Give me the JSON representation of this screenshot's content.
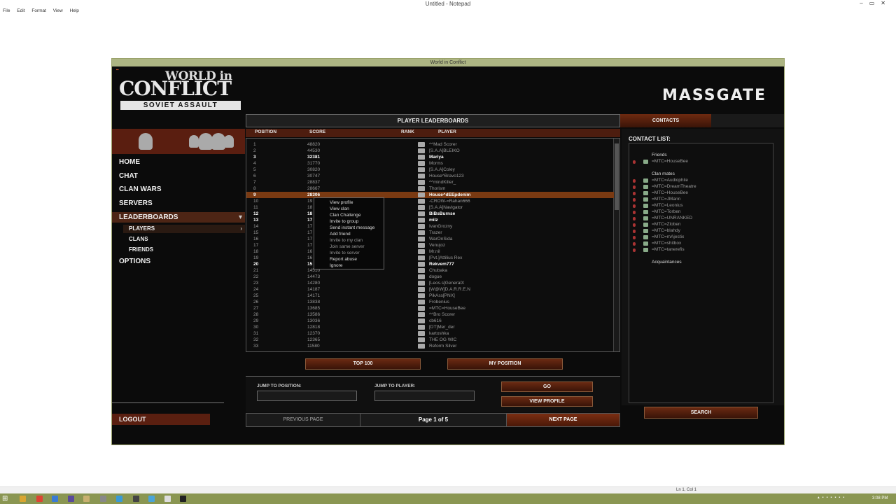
{
  "notepad": {
    "title": "Untitled - Notepad",
    "menu": [
      "File",
      "Edit",
      "Format",
      "View",
      "Help"
    ],
    "status": "Ln 1, Col 1"
  },
  "taskbar": {
    "clock": "3:08 PM"
  },
  "game": {
    "window_title": "World in Conflict",
    "logo": {
      "line1": "WORLD in",
      "line2": "CONFLICT",
      "line3": "SOVIET ASSAULT"
    },
    "massgate": "MASSGATE",
    "nav": {
      "home": "HOME",
      "chat": "CHAT",
      "clan_wars": "CLAN WARS",
      "servers": "SERVERS",
      "leaderboards": "LEADERBOARDS",
      "players": "PLAYERS",
      "clans": "CLANS",
      "friends": "FRIENDS",
      "options": "OPTIONS",
      "logout": "LOGOUT"
    },
    "leaderboard": {
      "title": "PLAYER LEADERBOARDS",
      "columns": {
        "position": "POSITION",
        "score": "SCORE",
        "rank": "RANK",
        "player": "PLAYER"
      },
      "rows": [
        {
          "pos": "1",
          "score": "48820",
          "player": "^^Mad Scorer"
        },
        {
          "pos": "2",
          "score": "44530",
          "player": "[S.A.A]BLEIKO"
        },
        {
          "pos": "3",
          "score": "32381",
          "player": "Mariya"
        },
        {
          "pos": "4",
          "score": "31770",
          "player": "Morms"
        },
        {
          "pos": "5",
          "score": "30820",
          "player": "[S.A.A]Coley"
        },
        {
          "pos": "6",
          "score": "30747",
          "player": "House^Bravo123"
        },
        {
          "pos": "7",
          "score": "28837",
          "player": "^^mindKiller_"
        },
        {
          "pos": "8",
          "score": "28667",
          "player": "Thorism"
        },
        {
          "pos": "9",
          "score": "28306",
          "player": "House^dEEpdenim"
        },
        {
          "pos": "10",
          "score": "19",
          "player": "-CROW-=Rahan666"
        },
        {
          "pos": "11",
          "score": "18",
          "player": "[S.A.A]Navigator"
        },
        {
          "pos": "12",
          "score": "18",
          "player": "BiBsBurnse"
        },
        {
          "pos": "13",
          "score": "17",
          "player": "milz"
        },
        {
          "pos": "14",
          "score": "17",
          "player": "IvanGrozny"
        },
        {
          "pos": "15",
          "score": "17",
          "player": "Trazer"
        },
        {
          "pos": "16",
          "score": "17",
          "player": "WarOnSida"
        },
        {
          "pos": "17",
          "score": "17",
          "player": "Venujoz"
        },
        {
          "pos": "18",
          "score": "16",
          "player": "Mr.nil"
        },
        {
          "pos": "19",
          "score": "16",
          "player": "[Pvt.]Attilius Rex"
        },
        {
          "pos": "20",
          "score": "15",
          "player": "Rekvem777"
        },
        {
          "pos": "21",
          "score": "14510",
          "player": "Chubaka"
        },
        {
          "pos": "22",
          "score": "14473",
          "player": "dogue"
        },
        {
          "pos": "23",
          "score": "14280",
          "player": "[Leos.s]GeneralX"
        },
        {
          "pos": "24",
          "score": "14187",
          "player": "[W@W]D.A.R.R.E.N"
        },
        {
          "pos": "25",
          "score": "14171",
          "player": "PikAss[PNX]"
        },
        {
          "pos": "26",
          "score": "13838",
          "player": "Frobenius"
        },
        {
          "pos": "27",
          "score": "13685",
          "player": "=MTC=HouseBee"
        },
        {
          "pos": "28",
          "score": "13586",
          "player": "^^Bro Scorer"
        },
        {
          "pos": "29",
          "score": "13036",
          "player": "cb616"
        },
        {
          "pos": "30",
          "score": "12818",
          "player": "[DT]Mer_der"
        },
        {
          "pos": "31",
          "score": "12370",
          "player": "kartoshka"
        },
        {
          "pos": "32",
          "score": "12365",
          "player": "THE OG WIC"
        },
        {
          "pos": "33",
          "score": "11580",
          "player": "Reform Silver"
        }
      ],
      "bold_rows": [
        3,
        9,
        12,
        13,
        20
      ],
      "top100": "TOP 100",
      "my_position": "MY POSITION",
      "jump_position_label": "JUMP TO POSITION:",
      "jump_player_label": "JUMP TO PLAYER:",
      "go": "GO",
      "view_profile": "VIEW PROFILE",
      "prev_page": "PREVIOUS PAGE",
      "page_info": "Page 1 of 5",
      "next_page": "NEXT PAGE"
    },
    "context_menu": [
      "View profile",
      "View clan",
      "Clan Challenge",
      "Invite to group",
      "Send instant message",
      "Add friend",
      "Invite to my clan",
      "Join same server",
      "Invite to server",
      "Report abuse",
      "Ignore"
    ],
    "contacts": {
      "tab": "CONTACTS",
      "title": "CONTACT LIST:",
      "friends_label": "Friends",
      "friends": [
        "=MTC=HouseBee"
      ],
      "clanmates_label": "Clan mates",
      "clanmates": [
        "=MTC=Audiophile",
        "=MTC=DreamTheatre",
        "=MTC=HouseBee",
        "=MTC=JMann",
        "=MTC=Leonius",
        "=MTC=Torben",
        "=MTC=UNRANKED",
        "=MTC=Zloben",
        "=MTC=blahdy",
        "=MTC=mAjestix",
        "=MTC=shitbox",
        "=MTC=tanerefis"
      ],
      "acquaintances_label": "Acquaintances",
      "search": "SEARCH"
    }
  }
}
